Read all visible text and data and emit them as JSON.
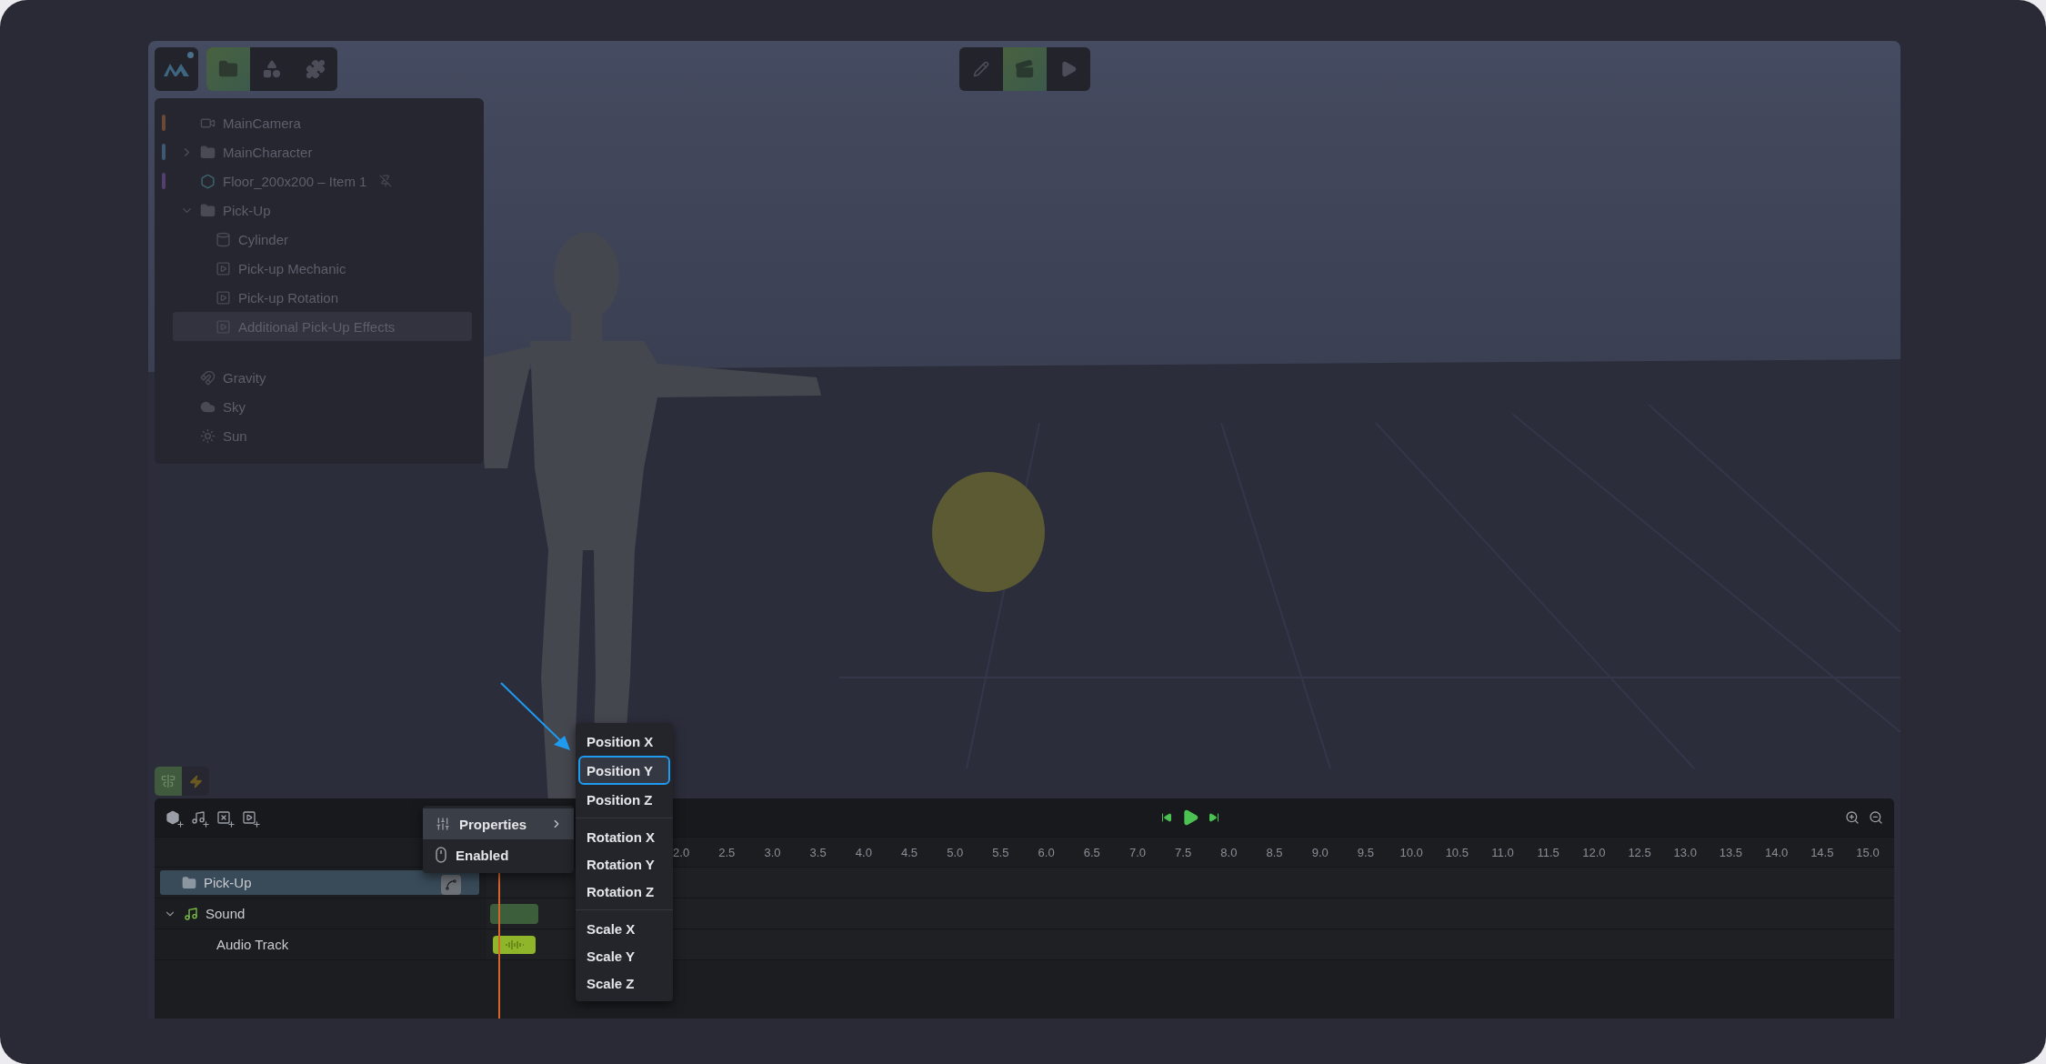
{
  "top_left_toolbar": {
    "tabs": [
      {
        "kind": "folder",
        "selected": true
      },
      {
        "kind": "shapes",
        "selected": false
      },
      {
        "kind": "plugins",
        "selected": false
      }
    ]
  },
  "mode_toolbar": {
    "buttons": [
      {
        "kind": "edit",
        "selected": false
      },
      {
        "kind": "scene",
        "selected": true
      },
      {
        "kind": "play",
        "selected": false
      }
    ]
  },
  "scene_tree": {
    "items": [
      {
        "label": "MainCamera",
        "kind": "camera",
        "color": "#6a4a34",
        "selected": false
      },
      {
        "label": "MainCharacter",
        "kind": "folder",
        "color": "#3e5a72",
        "expanded": false,
        "selected": false
      },
      {
        "label": "Floor_200x200 – Item 1",
        "kind": "mesh",
        "color": "#54406e",
        "pinned": true,
        "selected": false
      },
      {
        "label": "Pick-Up",
        "kind": "folder",
        "expanded": true,
        "selected": false,
        "children": [
          {
            "label": "Cylinder",
            "kind": "cylinder",
            "selected": false
          },
          {
            "label": "Pick-up Mechanic",
            "kind": "script",
            "selected": false
          },
          {
            "label": "Pick-up Rotation",
            "kind": "script",
            "selected": false
          },
          {
            "label": "Additional Pick-Up Effects",
            "kind": "script",
            "selected": true
          }
        ]
      }
    ],
    "environment": [
      {
        "label": "Gravity",
        "kind": "gravity"
      },
      {
        "label": "Sky",
        "kind": "sky"
      },
      {
        "label": "Sun",
        "kind": "sun"
      }
    ]
  },
  "timeline": {
    "side_tools": [
      {
        "kind": "align",
        "selected": true
      },
      {
        "kind": "bolt",
        "selected": false
      }
    ],
    "add_buttons": [
      {
        "kind": "object"
      },
      {
        "kind": "sound"
      },
      {
        "kind": "variable"
      },
      {
        "kind": "video"
      }
    ],
    "ruler": [
      "2.0",
      "2.5",
      "3.0",
      "3.5",
      "4.0",
      "4.5",
      "5.0",
      "5.5",
      "6.0",
      "6.5",
      "7.0",
      "7.5",
      "8.0",
      "8.5",
      "9.0",
      "9.5",
      "10.0",
      "10.5",
      "11.0",
      "11.5",
      "12.0",
      "12.5",
      "13.0",
      "13.5",
      "14.0",
      "14.5",
      "15.0"
    ],
    "tracks": [
      {
        "label": "Pick-Up",
        "kind": "folder",
        "selected": true
      },
      {
        "label": "Sound",
        "kind": "sound",
        "selected": false,
        "expanded": true,
        "children": [
          {
            "label": "Audio Track",
            "kind": "audio",
            "selected": false
          }
        ]
      }
    ]
  },
  "context_menu": {
    "items": [
      {
        "label": "Properties",
        "kind": "submenu",
        "selected": true
      },
      {
        "label": "Enabled",
        "kind": "toggle",
        "selected": false
      }
    ]
  },
  "properties_submenu": {
    "groups": [
      [
        {
          "label": "Position X",
          "selected": false
        },
        {
          "label": "Position Y",
          "selected": true
        },
        {
          "label": "Position Z",
          "selected": false
        }
      ],
      [
        {
          "label": "Rotation X",
          "selected": false
        },
        {
          "label": "Rotation Y",
          "selected": false
        },
        {
          "label": "Rotation Z",
          "selected": false
        }
      ],
      [
        {
          "label": "Scale X",
          "selected": false
        },
        {
          "label": "Scale Y",
          "selected": false
        },
        {
          "label": "Scale Z",
          "selected": false
        }
      ]
    ]
  }
}
